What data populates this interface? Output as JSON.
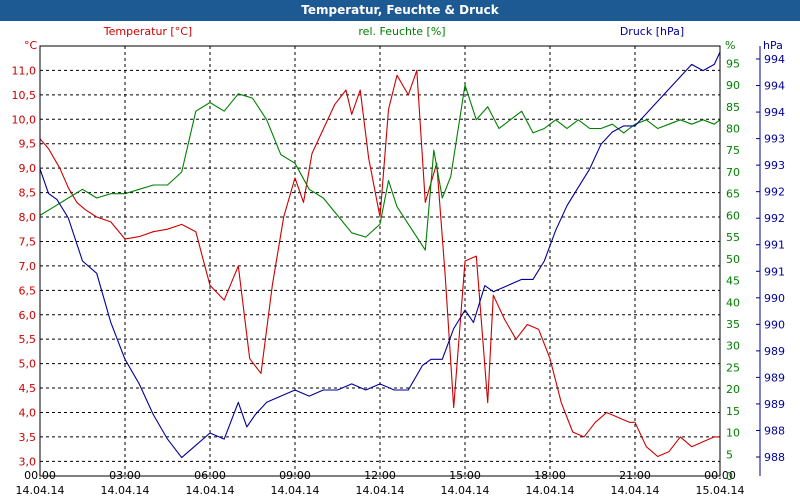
{
  "window": {
    "title": "Temperatur, Feuchte & Druck"
  },
  "chart_data": {
    "type": "line",
    "grid": true,
    "x_ticks": [
      {
        "time": "00:00",
        "date": "14.04.14"
      },
      {
        "time": "03:00",
        "date": "14.04.14"
      },
      {
        "time": "06:00",
        "date": "14.04.14"
      },
      {
        "time": "09:00",
        "date": "14.04.14"
      },
      {
        "time": "12:00",
        "date": "14.04.14"
      },
      {
        "time": "15:00",
        "date": "14.04.14"
      },
      {
        "time": "18:00",
        "date": "14.04.14"
      },
      {
        "time": "21:00",
        "date": "14.04.14"
      },
      {
        "time": "00:00",
        "date": "15.04.14"
      }
    ],
    "xlim": [
      0,
      24
    ],
    "axes": {
      "temperature": {
        "label": "Temperatur [°C]",
        "unit": "°C",
        "color": "#cc0000",
        "ylim": [
          2.7,
          11.5
        ],
        "ticks": [
          "3,0",
          "3,5",
          "4,0",
          "4,5",
          "5,0",
          "5,5",
          "6,0",
          "6,5",
          "7,0",
          "7,5",
          "8,0",
          "8,5",
          "9,0",
          "9,5",
          "10,0",
          "10,5",
          "11,0"
        ]
      },
      "humidity": {
        "label": "rel. Feuchte [%]",
        "unit": "%",
        "color": "#008000",
        "ylim": [
          0,
          99
        ],
        "ticks": [
          "0",
          "5",
          "10",
          "15",
          "20",
          "25",
          "30",
          "35",
          "40",
          "45",
          "50",
          "55",
          "60",
          "65",
          "70",
          "75",
          "80",
          "85",
          "90",
          "95"
        ]
      },
      "pressure": {
        "label": "Druck [hPa]",
        "unit": "hPa",
        "color": "#000099",
        "ylim": [
          987.5,
          994.5
        ],
        "ticks": [
          "988",
          "988",
          "989",
          "989",
          "989",
          "990",
          "990",
          "991",
          "991",
          "992",
          "992",
          "993",
          "993",
          "994",
          "994",
          "994"
        ]
      }
    },
    "series": [
      {
        "name": "Temperatur [°C]",
        "axis": "temperature",
        "color": "#cc0000",
        "x": [
          0,
          0.3,
          0.7,
          1,
          1.3,
          1.6,
          2,
          2.5,
          3,
          3.5,
          4,
          4.5,
          5,
          5.5,
          6,
          6.5,
          7,
          7.4,
          7.8,
          8.2,
          8.6,
          9,
          9.3,
          9.6,
          10,
          10.4,
          10.8,
          11,
          11.3,
          11.6,
          12,
          12.3,
          12.6,
          13,
          13.3,
          13.6,
          14,
          14.3,
          14.6,
          15,
          15.4,
          15.8,
          16,
          16.4,
          16.8,
          17.2,
          17.6,
          18,
          18.4,
          18.8,
          19.2,
          19.6,
          20,
          20.4,
          20.8,
          21,
          21.4,
          21.8,
          22.2,
          22.6,
          23,
          23.4,
          23.8,
          24
        ],
        "values": [
          9.6,
          9.4,
          9.0,
          8.6,
          8.3,
          8.15,
          8.0,
          7.9,
          7.55,
          7.6,
          7.7,
          7.75,
          7.85,
          7.7,
          6.6,
          6.3,
          7.0,
          5.1,
          4.8,
          6.6,
          8.0,
          8.8,
          8.3,
          9.3,
          9.8,
          10.3,
          10.6,
          10.1,
          10.6,
          9.2,
          8.0,
          10.2,
          10.9,
          10.5,
          11.0,
          8.3,
          9.1,
          6.8,
          4.1,
          7.1,
          7.2,
          4.2,
          6.4,
          5.9,
          5.5,
          5.8,
          5.7,
          5.1,
          4.2,
          3.6,
          3.5,
          3.8,
          4.0,
          3.9,
          3.8,
          3.8,
          3.3,
          3.1,
          3.2,
          3.5,
          3.3,
          3.4,
          3.5,
          3.5
        ]
      },
      {
        "name": "rel. Feuchte [%]",
        "axis": "humidity",
        "color": "#008000",
        "x": [
          0,
          0.5,
          1,
          1.5,
          2,
          2.5,
          3,
          3.5,
          4,
          4.5,
          5,
          5.5,
          6,
          6.5,
          7,
          7.5,
          8,
          8.5,
          9,
          9.5,
          10,
          10.5,
          11,
          11.5,
          12,
          12.3,
          12.6,
          13,
          13.3,
          13.6,
          13.9,
          14.2,
          14.5,
          15,
          15.4,
          15.8,
          16.2,
          16.6,
          17,
          17.4,
          17.8,
          18.2,
          18.6,
          19,
          19.4,
          19.8,
          20.2,
          20.6,
          21,
          21.4,
          21.8,
          22.2,
          22.6,
          23,
          23.4,
          23.8,
          24
        ],
        "values": [
          60,
          62,
          64,
          66,
          64,
          65,
          65,
          66,
          67,
          67,
          70,
          84,
          86,
          84,
          88,
          87,
          82,
          74,
          72,
          66,
          64,
          60,
          56,
          55,
          58,
          68,
          62,
          58,
          55,
          52,
          75,
          64,
          69,
          90,
          82,
          85,
          80,
          82,
          84,
          79,
          80,
          82,
          80,
          82,
          80,
          80,
          81,
          79,
          81,
          82,
          80,
          81,
          82,
          81,
          82,
          81,
          82
        ]
      },
      {
        "name": "Druck [hPa]",
        "axis": "pressure",
        "color": "#000099",
        "x": [
          0,
          0.3,
          0.6,
          1,
          1.5,
          2,
          2.5,
          3,
          3.5,
          4,
          4.5,
          5,
          5.5,
          6,
          6.5,
          7,
          7.3,
          7.6,
          8,
          8.5,
          9,
          9.5,
          10,
          10.5,
          11,
          11.5,
          12,
          12.5,
          13,
          13.5,
          13.8,
          14.2,
          14.6,
          15,
          15.3,
          15.7,
          16,
          16.5,
          17,
          17.4,
          17.8,
          18.2,
          18.6,
          19,
          19.4,
          19.8,
          20.2,
          20.6,
          21,
          21.4,
          21.8,
          22.2,
          22.6,
          23,
          23.4,
          23.8,
          24
        ],
        "values": [
          992.5,
          992.1,
          992.0,
          991.7,
          991.0,
          990.8,
          990.0,
          989.4,
          989.0,
          988.5,
          988.1,
          987.8,
          988.0,
          988.2,
          988.1,
          988.7,
          988.3,
          988.5,
          988.7,
          988.8,
          988.9,
          988.8,
          988.9,
          988.9,
          989.0,
          988.9,
          989.0,
          988.9,
          988.9,
          989.3,
          989.4,
          989.4,
          989.9,
          990.2,
          990.0,
          990.6,
          990.5,
          990.6,
          990.7,
          990.7,
          991.0,
          991.5,
          991.9,
          992.2,
          992.5,
          992.9,
          993.1,
          993.2,
          993.2,
          993.4,
          993.6,
          993.8,
          994.0,
          994.2,
          994.1,
          994.2,
          994.4
        ]
      }
    ]
  }
}
